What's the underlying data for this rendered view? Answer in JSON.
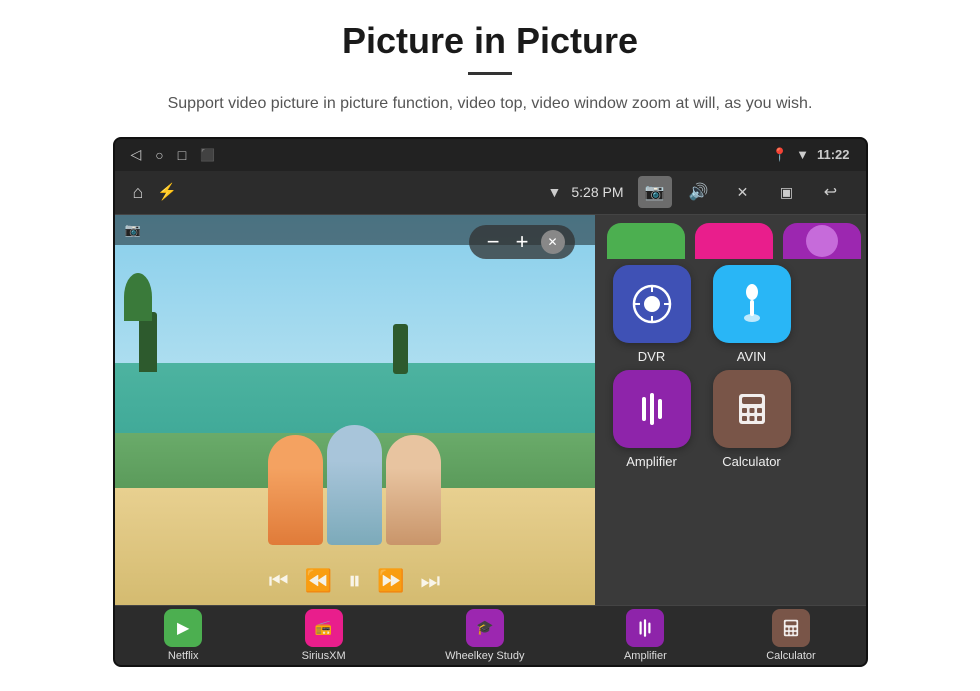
{
  "header": {
    "title": "Picture in Picture",
    "subtitle": "Support video picture in picture function, video top, video window zoom at will, as you wish."
  },
  "statusBar": {
    "time": "11:22",
    "icons": [
      "back",
      "circle",
      "square",
      "cast"
    ]
  },
  "toolbar": {
    "time": "5:28 PM",
    "icons": [
      "home",
      "usb",
      "wifi",
      "camera",
      "volume",
      "close-x",
      "pip",
      "back-arrow"
    ]
  },
  "pipControls": {
    "minus": "−",
    "plus": "+",
    "close": "✕"
  },
  "appsGrid": {
    "topPartial": [
      {
        "name": "netflix-partial",
        "color": "green",
        "label": ""
      },
      {
        "name": "siriusxm-partial",
        "color": "pink",
        "label": ""
      },
      {
        "name": "wheelkey-partial",
        "color": "purple",
        "label": ""
      }
    ],
    "row1": [
      {
        "id": "dvr",
        "label": "DVR",
        "color": "#3f51b5",
        "icon": "📡"
      },
      {
        "id": "avin",
        "label": "AVIN",
        "color": "#29b6f6",
        "icon": "🔌"
      }
    ],
    "row2": [
      {
        "id": "amplifier",
        "label": "Amplifier",
        "color": "#8e24aa",
        "icon": "🎛"
      },
      {
        "id": "calculator",
        "label": "Calculator",
        "color": "#795548",
        "icon": "🔢"
      }
    ]
  },
  "bottomBar": {
    "apps": [
      {
        "id": "netflix",
        "label": "Netflix",
        "color": "#4caf50",
        "icon": "▶"
      },
      {
        "id": "siriusxm",
        "label": "SiriusXM",
        "color": "#e91e8c",
        "icon": "📻"
      },
      {
        "id": "wheelkey-study",
        "label": "Wheelkey Study",
        "color": "#9c27b0",
        "icon": "🎓"
      },
      {
        "id": "amplifier-bottom",
        "label": "Amplifier",
        "color": "#8e24aa",
        "icon": "🎛"
      },
      {
        "id": "calculator-bottom",
        "label": "Calculator",
        "color": "#795548",
        "icon": "🔢"
      }
    ]
  }
}
